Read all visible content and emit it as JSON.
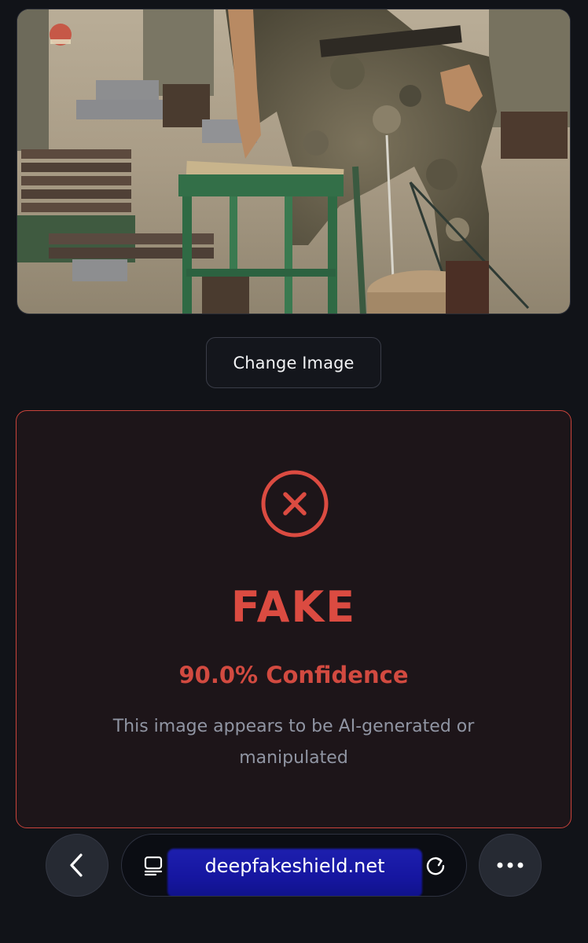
{
  "photo": {
    "alt": "Soldier breaking a board on a green wooden stool"
  },
  "actions": {
    "change_image_label": "Change Image"
  },
  "result": {
    "verdict": "FAKE",
    "confidence": "90.0% Confidence",
    "description": "This image appears to be AI-generated or manipulated",
    "accent_color": "#db4b41",
    "status_icon": "x-circle-icon"
  },
  "browser": {
    "url": "deepfakeshield.net",
    "icons": [
      "back-icon",
      "tabs-icon",
      "reload-icon",
      "more-icon"
    ]
  }
}
